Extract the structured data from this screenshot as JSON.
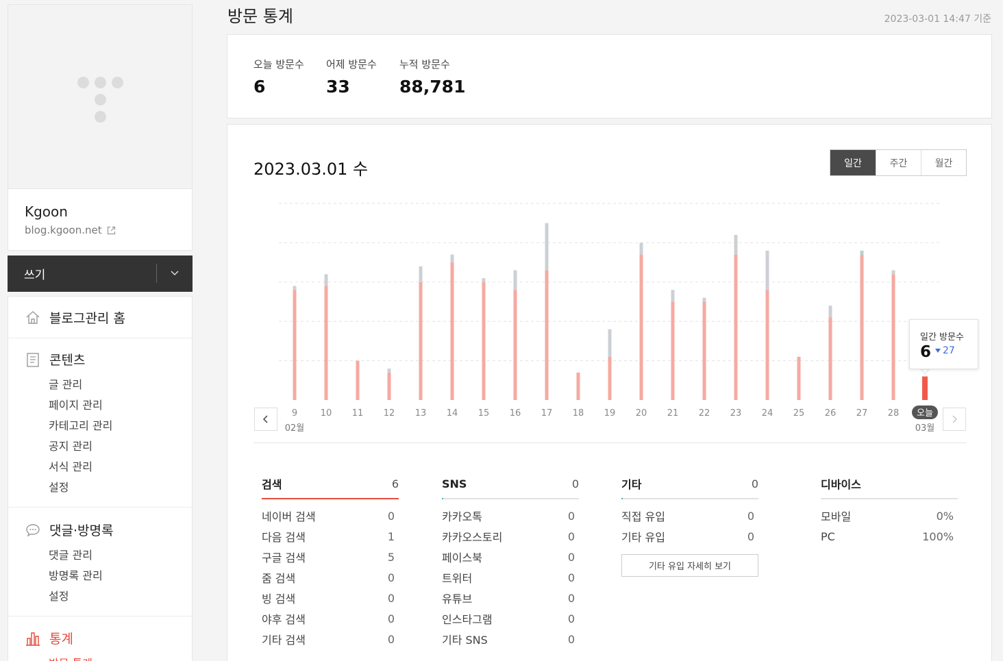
{
  "sidebar": {
    "blog_name": "Kgoon",
    "blog_url": "blog.kgoon.net",
    "write_label": "쓰기",
    "home_label": "블로그관리 홈",
    "contents": {
      "title": "콘텐츠",
      "items": [
        "글 관리",
        "페이지 관리",
        "카테고리 관리",
        "공지 관리",
        "서식 관리",
        "설정"
      ]
    },
    "comments": {
      "title": "댓글·방명록",
      "items": [
        "댓글 관리",
        "방명록 관리",
        "설정"
      ]
    },
    "stats": {
      "title": "통계",
      "items": [
        "방문 통계"
      ]
    }
  },
  "header": {
    "title": "방문 통계",
    "timestamp": "2023-03-01 14:47 기준"
  },
  "summary": {
    "today_label": "오늘 방문수",
    "today_value": "6",
    "yesterday_label": "어제 방문수",
    "yesterday_value": "33",
    "total_label": "누적 방문수",
    "total_value": "88,781"
  },
  "chart_header": {
    "date": "2023.03.01 수",
    "tabs": [
      "일간",
      "주간",
      "월간"
    ],
    "active_tab": "일간"
  },
  "tooltip": {
    "label": "일간 방문수",
    "value": "6",
    "delta": "27",
    "delta_direction": "down"
  },
  "chart_data": {
    "type": "bar",
    "categories": [
      "9",
      "10",
      "11",
      "12",
      "13",
      "14",
      "15",
      "16",
      "17",
      "18",
      "19",
      "20",
      "21",
      "22",
      "23",
      "24",
      "25",
      "26",
      "27",
      "28",
      "오늘"
    ],
    "month_labels": {
      "start": "02월",
      "end": "03월"
    },
    "series": [
      {
        "values": [
          28,
          29,
          10,
          7,
          30,
          35,
          30,
          28,
          33,
          7,
          11,
          37,
          25,
          25,
          37,
          28,
          11,
          21,
          37,
          32,
          6
        ]
      },
      {
        "values": [
          1,
          3,
          0,
          1,
          4,
          2,
          1,
          5,
          12,
          0,
          7,
          3,
          3,
          1,
          5,
          10,
          0,
          3,
          1,
          1,
          0
        ]
      }
    ],
    "colors": [
      "#f5aaa1",
      "#ccd0d5"
    ],
    "highlight_color": "#f15a4a",
    "ylim": [
      0,
      50
    ],
    "grid": true
  },
  "sources": {
    "search": {
      "title": "검색",
      "count": "6",
      "rows": [
        {
          "label": "네이버 검색",
          "value": "0"
        },
        {
          "label": "다음 검색",
          "value": "1"
        },
        {
          "label": "구글 검색",
          "value": "5"
        },
        {
          "label": "줌 검색",
          "value": "0"
        },
        {
          "label": "빙 검색",
          "value": "0"
        },
        {
          "label": "야후 검색",
          "value": "0"
        },
        {
          "label": "기타 검색",
          "value": "0"
        }
      ]
    },
    "sns": {
      "title": "SNS",
      "count": "0",
      "rows": [
        {
          "label": "카카오톡",
          "value": "0"
        },
        {
          "label": "카카오스토리",
          "value": "0"
        },
        {
          "label": "페이스북",
          "value": "0"
        },
        {
          "label": "트위터",
          "value": "0"
        },
        {
          "label": "유튜브",
          "value": "0"
        },
        {
          "label": "인스타그램",
          "value": "0"
        },
        {
          "label": "기타 SNS",
          "value": "0"
        }
      ]
    },
    "etc": {
      "title": "기타",
      "count": "0",
      "rows": [
        {
          "label": "직접 유입",
          "value": "0"
        },
        {
          "label": "기타 유입",
          "value": "0"
        }
      ],
      "more_button": "기타 유입 자세히 보기"
    },
    "device": {
      "title": "디바이스",
      "rows": [
        {
          "label": "모바일",
          "value": "0%"
        },
        {
          "label": "PC",
          "value": "100%"
        }
      ]
    }
  }
}
